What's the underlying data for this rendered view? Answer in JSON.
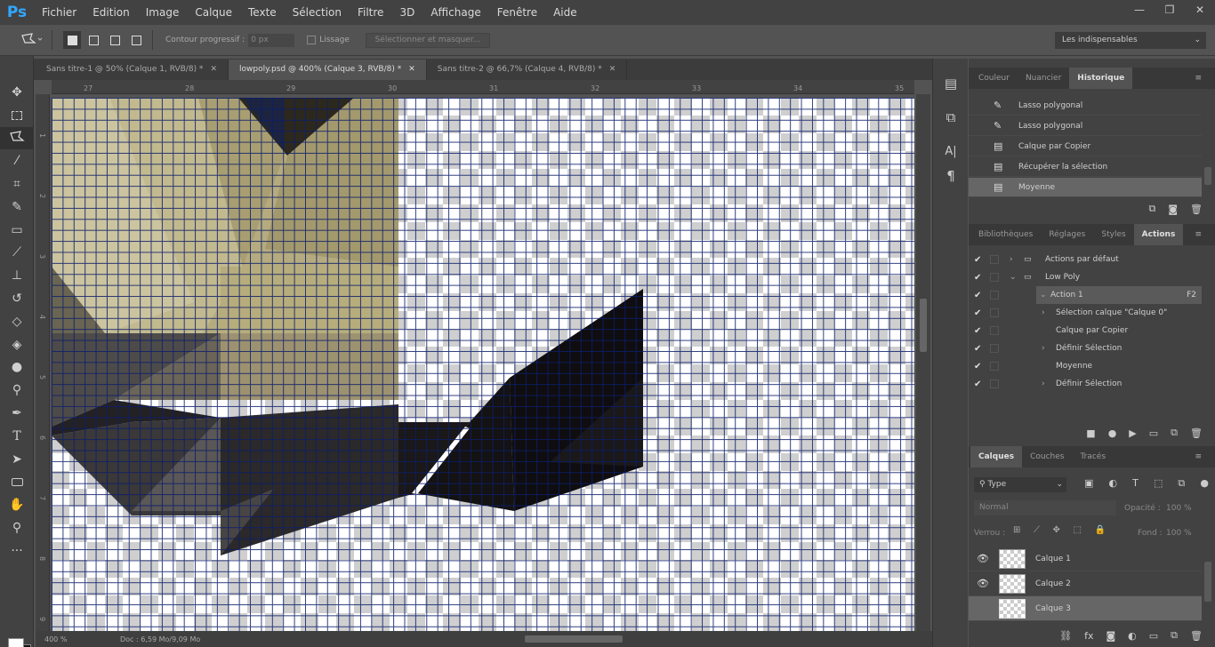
{
  "app": {
    "logo": "Ps"
  },
  "menu": [
    "Fichier",
    "Edition",
    "Image",
    "Calque",
    "Texte",
    "Sélection",
    "Filtre",
    "3D",
    "Affichage",
    "Fenêtre",
    "Aide"
  ],
  "window_controls": {
    "minimize": "—",
    "restore": "❐",
    "close": "✕"
  },
  "options": {
    "feather_label": "Contour progressif :",
    "feather_value": "0 px",
    "antialias_label": "Lissage",
    "select_mask_label": "Sélectionner et masquer...",
    "workspace": "Les indispensables"
  },
  "tabs": [
    {
      "label": "Sans titre-1 @ 50% (Calque 1, RVB/8) *",
      "active": false
    },
    {
      "label": "lowpoly.psd @ 400% (Calque 3, RVB/8) *",
      "active": true
    },
    {
      "label": "Sans titre-2 @ 66,7% (Calque 4, RVB/8) *",
      "active": false
    }
  ],
  "ruler_h": [
    "27",
    "28",
    "29",
    "30",
    "31",
    "32",
    "33",
    "34",
    "35"
  ],
  "ruler_v": [
    "1",
    "2",
    "3",
    "4",
    "5",
    "6",
    "7",
    "8",
    "9"
  ],
  "status": {
    "zoom": "400 %",
    "doc": "Doc : 6,59 Mo/9,09 Mo"
  },
  "history_panel": {
    "tabs": [
      "Couleur",
      "Nuancier",
      "Historique"
    ],
    "active_tab": "Historique",
    "items": [
      {
        "label": "Lasso polygonal",
        "icon": "lasso-icon",
        "selected": false
      },
      {
        "label": "Lasso polygonal",
        "icon": "lasso-icon",
        "selected": false
      },
      {
        "label": "Calque par Copier",
        "icon": "document-icon",
        "selected": false
      },
      {
        "label": "Récupérer la sélection",
        "icon": "document-icon",
        "selected": false
      },
      {
        "label": "Moyenne",
        "icon": "document-icon",
        "selected": true
      }
    ]
  },
  "actions_panel": {
    "tabs": [
      "Bibliothèques",
      "Réglages",
      "Styles",
      "Actions"
    ],
    "active_tab": "Actions",
    "items": [
      {
        "label": "Actions par défaut",
        "level": 0,
        "type": "folder",
        "expanded": false
      },
      {
        "label": "Low Poly",
        "level": 0,
        "type": "folder",
        "expanded": true
      },
      {
        "label": "Action 1",
        "level": 1,
        "type": "action",
        "expanded": true,
        "shortcut": "F2",
        "selected": true
      },
      {
        "label": "Sélection calque \"Calque 0\"",
        "level": 2,
        "type": "step",
        "expandable": true
      },
      {
        "label": "Calque par Copier",
        "level": 2,
        "type": "step",
        "expandable": false
      },
      {
        "label": "Définir Sélection",
        "level": 2,
        "type": "step",
        "expandable": true
      },
      {
        "label": "Moyenne",
        "level": 2,
        "type": "step",
        "expandable": false
      },
      {
        "label": "Définir Sélection",
        "level": 2,
        "type": "step",
        "expandable": true
      }
    ]
  },
  "layers_panel": {
    "tabs": [
      "Calques",
      "Couches",
      "Tracés"
    ],
    "active_tab": "Calques",
    "filter": "Type",
    "blend_mode": "Normal",
    "opacity_label": "Opacité :",
    "opacity_value": "100 %",
    "lock_label": "Verrou :",
    "fill_label": "Fond :",
    "fill_value": "100 %",
    "layers": [
      {
        "name": "Calque 1",
        "visible": true,
        "selected": false
      },
      {
        "name": "Calque 2",
        "visible": true,
        "selected": false
      },
      {
        "name": "Calque 3",
        "visible": false,
        "selected": true
      }
    ]
  },
  "colors": {
    "accent": "#31a8ff",
    "panel": "#424242",
    "canvas_bg": "#535353"
  }
}
